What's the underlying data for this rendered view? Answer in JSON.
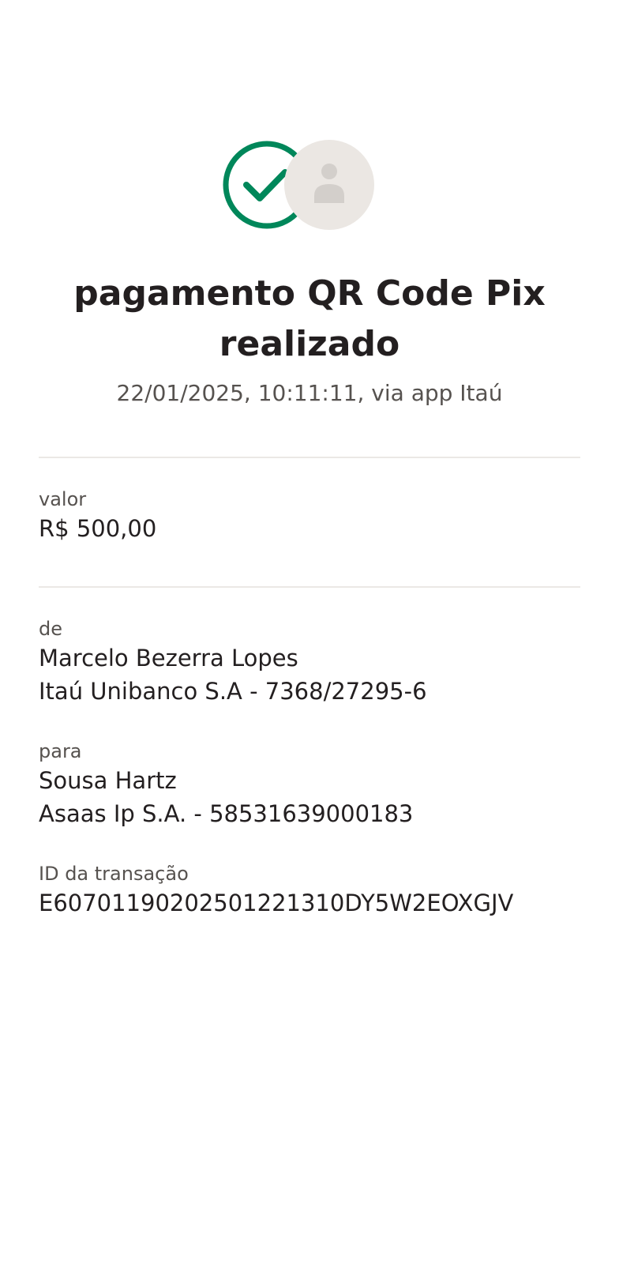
{
  "header": {
    "title_line1": "pagamento QR Code Pix",
    "title_line2": "realizado",
    "subtitle": "22/01/2025,  10:11:11, via app Itaú",
    "status_icon": "check-circle-icon",
    "avatar_icon": "person-icon"
  },
  "details": {
    "valor": {
      "label": "valor",
      "value": "R$ 500,00"
    },
    "de": {
      "label": "de",
      "name": "Marcelo Bezerra Lopes",
      "account": "Itaú Unibanco S.A - 7368/27295-6"
    },
    "para": {
      "label": "para",
      "name": "Sousa Hartz",
      "account": "Asaas Ip S.A. - 58531639000183"
    },
    "transacao": {
      "label": "ID da transação",
      "value": "E60701190202501221310DY5W2EOXGJV"
    }
  },
  "colors": {
    "success": "#00875a",
    "avatar_bg": "#ebe7e3",
    "avatar_fg": "#d3cfcb",
    "divider": "#ebe8e5",
    "label": "#56524f",
    "text": "#231f20"
  }
}
